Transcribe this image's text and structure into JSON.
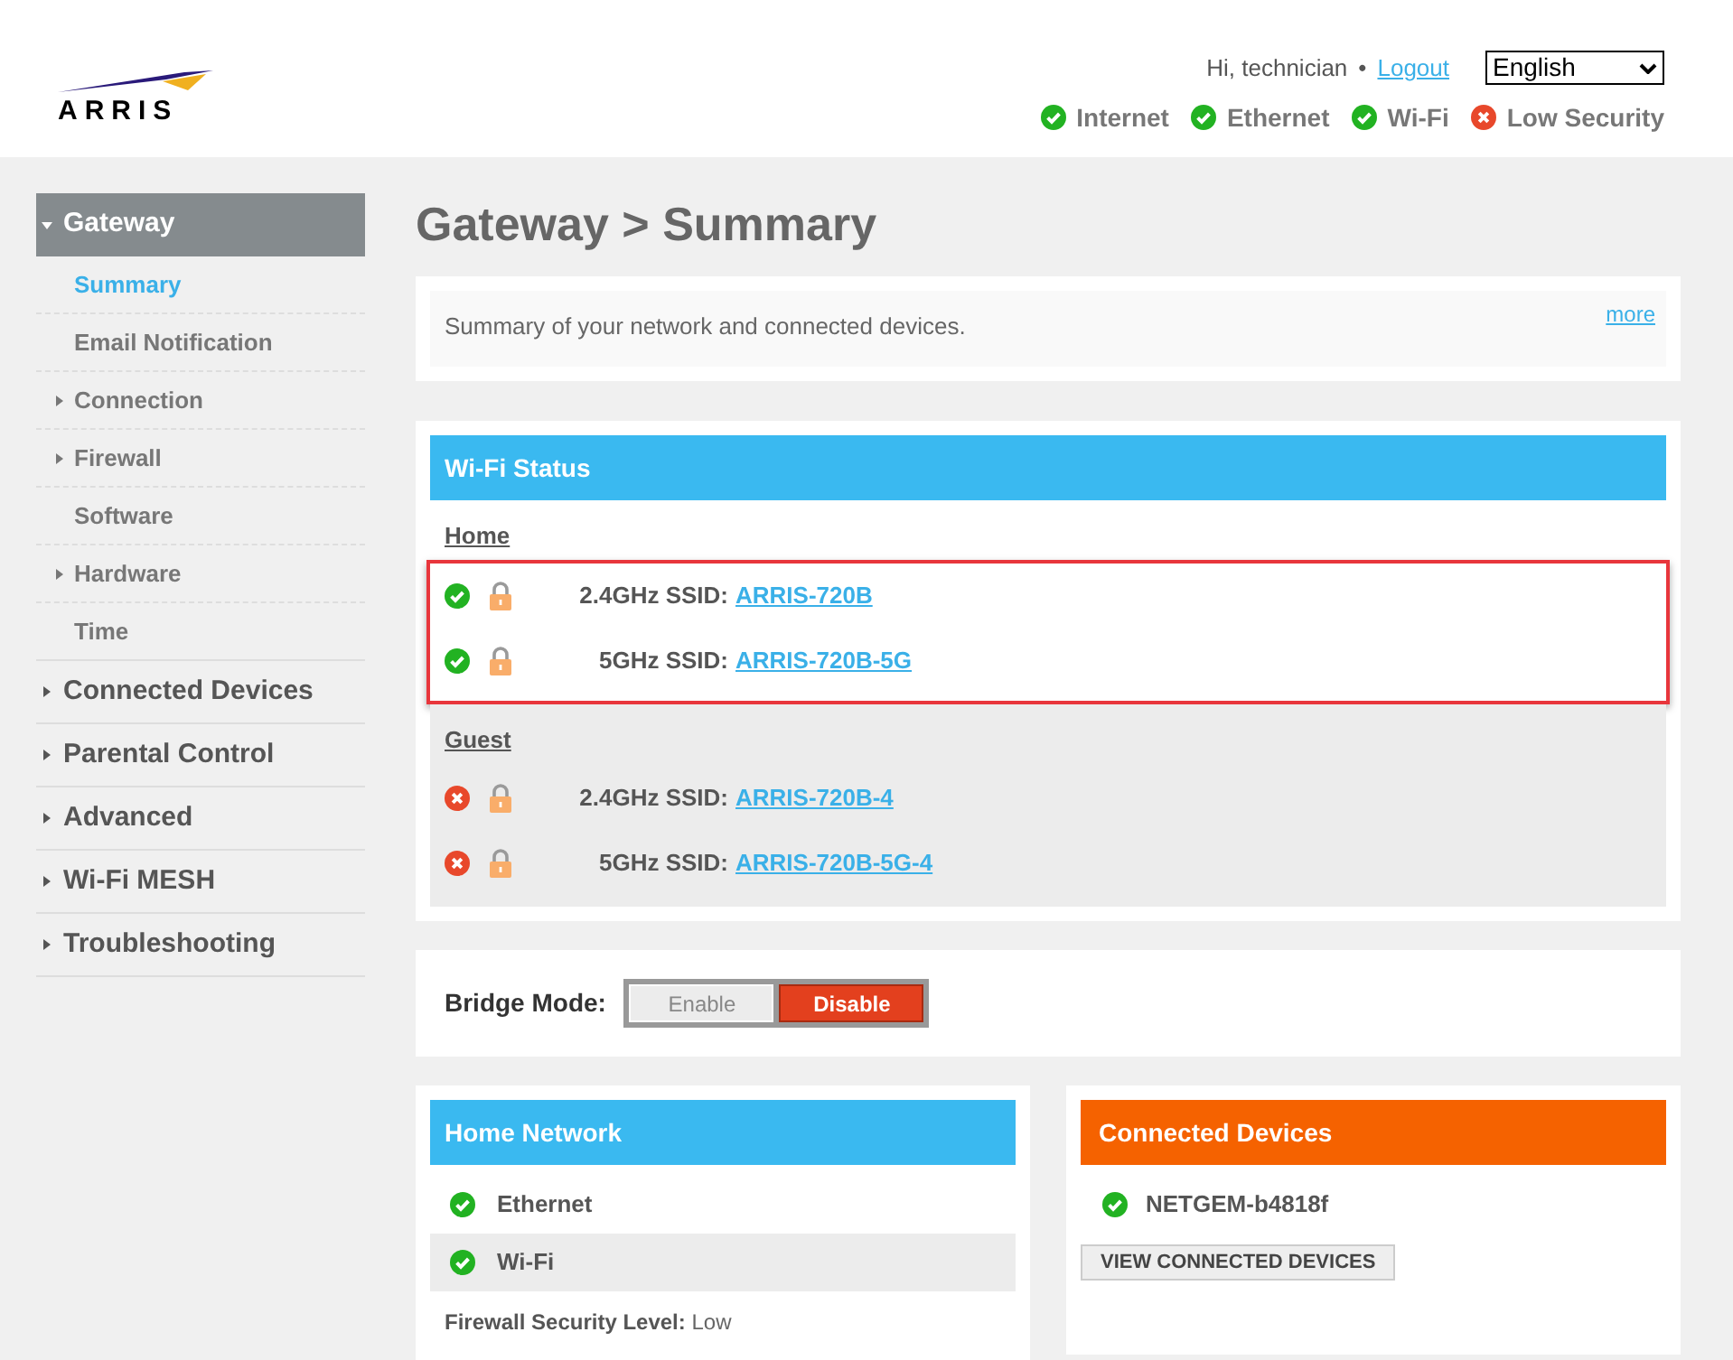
{
  "header": {
    "logo": "ARRIS",
    "greeting": "Hi, technician",
    "separator": "•",
    "logout": "Logout",
    "language": "English",
    "status": [
      {
        "label": "Internet",
        "ok": true
      },
      {
        "label": "Ethernet",
        "ok": true
      },
      {
        "label": "Wi-Fi",
        "ok": true
      },
      {
        "label": "Low Security",
        "ok": false
      }
    ]
  },
  "sidebar": {
    "items": [
      {
        "label": "Gateway",
        "expanded": true,
        "children": [
          {
            "label": "Summary",
            "selected": true,
            "expandable": false
          },
          {
            "label": "Email Notification",
            "selected": false,
            "expandable": false
          },
          {
            "label": "Connection",
            "selected": false,
            "expandable": true
          },
          {
            "label": "Firewall",
            "selected": false,
            "expandable": true
          },
          {
            "label": "Software",
            "selected": false,
            "expandable": false
          },
          {
            "label": "Hardware",
            "selected": false,
            "expandable": true
          },
          {
            "label": "Time",
            "selected": false,
            "expandable": false
          }
        ]
      },
      {
        "label": "Connected Devices",
        "expanded": false
      },
      {
        "label": "Parental Control",
        "expanded": false
      },
      {
        "label": "Advanced",
        "expanded": false
      },
      {
        "label": "Wi-Fi MESH",
        "expanded": false
      },
      {
        "label": "Troubleshooting",
        "expanded": false
      }
    ]
  },
  "page_title": "Gateway > Summary",
  "intro": {
    "text": "Summary of your network and connected devices.",
    "more": "more"
  },
  "wifi_status": {
    "title": "Wi-Fi Status",
    "groups": [
      {
        "name": "Home",
        "highlighted": true,
        "networks": [
          {
            "band": "2.4GHz SSID:",
            "ssid": "ARRIS-720B",
            "ok": true
          },
          {
            "band": "5GHz SSID:",
            "ssid": "ARRIS-720B-5G",
            "ok": true
          }
        ]
      },
      {
        "name": "Guest",
        "highlighted": false,
        "networks": [
          {
            "band": "2.4GHz SSID:",
            "ssid": "ARRIS-720B-4",
            "ok": false
          },
          {
            "band": "5GHz SSID:",
            "ssid": "ARRIS-720B-5G-4",
            "ok": false
          }
        ]
      }
    ]
  },
  "bridge_mode": {
    "label": "Bridge Mode:",
    "options": [
      {
        "label": "Enable",
        "selected": false
      },
      {
        "label": "Disable",
        "selected": true
      }
    ]
  },
  "home_network": {
    "title": "Home Network",
    "items": [
      {
        "label": "Ethernet",
        "ok": true
      },
      {
        "label": "Wi-Fi",
        "ok": true
      }
    ],
    "firewall_label": "Firewall Security Level:",
    "firewall_value": "Low"
  },
  "connected_devices": {
    "title": "Connected Devices",
    "devices": [
      {
        "name": "NETGEM-b4818f",
        "ok": true
      }
    ],
    "button": "VIEW CONNECTED DEVICES"
  }
}
